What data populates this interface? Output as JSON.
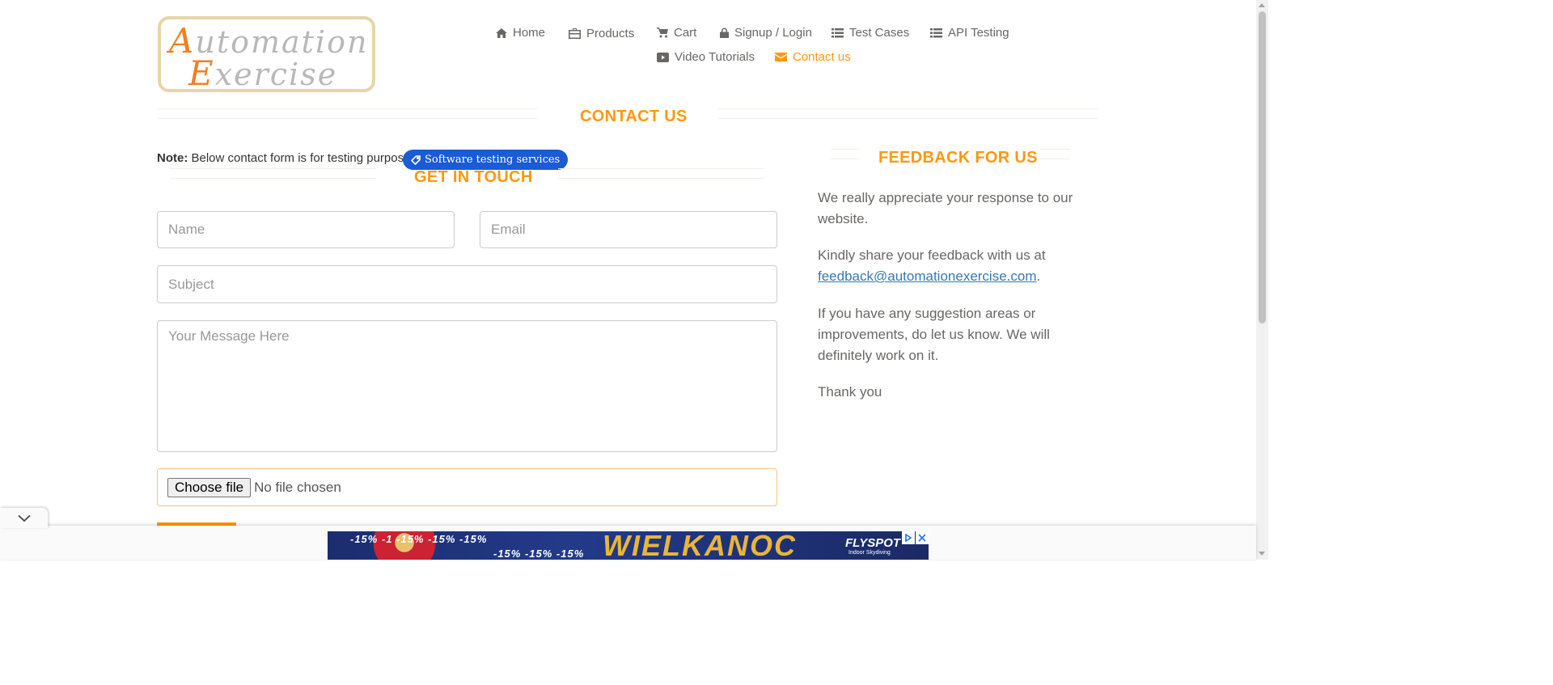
{
  "logo": {
    "line1_cap": "A",
    "line1_rest": "utomation",
    "line2_cap": "E",
    "line2_rest": "xercise"
  },
  "nav": {
    "items": [
      {
        "label": "Home",
        "icon": "home-icon"
      },
      {
        "label": "Products",
        "icon": "briefcase-icon"
      },
      {
        "label": "Cart",
        "icon": "cart-icon"
      },
      {
        "label": "Signup / Login",
        "icon": "lock-icon"
      },
      {
        "label": "Test Cases",
        "icon": "list-icon"
      },
      {
        "label": "API Testing",
        "icon": "list-icon"
      },
      {
        "label": "Video Tutorials",
        "icon": "youtube-icon"
      },
      {
        "label": "Contact us",
        "icon": "envelope-icon",
        "active": true
      }
    ],
    "active_color": "#fe980f"
  },
  "contact": {
    "title": "CONTACT US",
    "note_bold": "Note:",
    "note_text": " Below contact form is for testing purpose.",
    "ad_pill": "Software testing services",
    "get_in_touch": "GET IN TOUCH",
    "form": {
      "name_placeholder": "Name",
      "email_placeholder": "Email",
      "subject_placeholder": "Subject",
      "message_placeholder": "Your Message Here",
      "file_button": "Choose file",
      "file_status": "No file chosen"
    }
  },
  "feedback": {
    "title": "FEEDBACK FOR US",
    "p1": "We really appreciate your response to our website.",
    "p2_prefix": "Kindly share your feedback with us at",
    "p2_email": "feedback@automationexercise.com",
    "p2_suffix": ".",
    "p3": "If you have any suggestion areas or improvements, do let us know. We will definitely work on it.",
    "p4": "Thank you"
  },
  "ad": {
    "pct_row1": "-15% -1     -15%  -15%  -15%",
    "pct_row2": "-15%  -15%  -15%",
    "headline": "WIELKANOC",
    "brand": "FLYSPOT",
    "brand_sub": "Indoor Skydiving"
  },
  "colors": {
    "accent": "#fe980f",
    "text": "#696763",
    "link": "#337ab7",
    "ad_pill": "#1a5bd6"
  }
}
